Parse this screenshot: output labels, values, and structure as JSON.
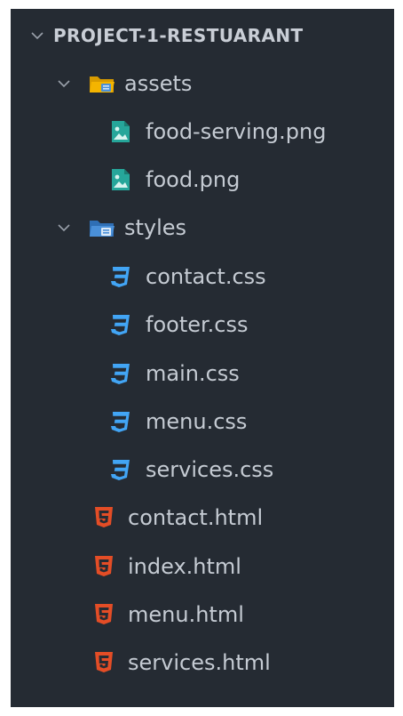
{
  "explorer": {
    "root": {
      "label": "PROJECT-1-RESTUARANT",
      "expanded": true,
      "icon": "chevron-down-icon"
    },
    "folders": [
      {
        "label": "assets",
        "expanded": true,
        "icon": "folder-open-images-icon",
        "files": [
          {
            "label": "food-serving.png",
            "icon": "image-file-icon"
          },
          {
            "label": "food.png",
            "icon": "image-file-icon"
          }
        ]
      },
      {
        "label": "styles",
        "expanded": true,
        "icon": "folder-open-styles-icon",
        "files": [
          {
            "label": "contact.css",
            "icon": "css3-icon"
          },
          {
            "label": "footer.css",
            "icon": "css3-icon"
          },
          {
            "label": "main.css",
            "icon": "css3-icon"
          },
          {
            "label": "menu.css",
            "icon": "css3-icon"
          },
          {
            "label": "services.css",
            "icon": "css3-icon"
          }
        ]
      }
    ],
    "files": [
      {
        "label": "contact.html",
        "icon": "html5-icon"
      },
      {
        "label": "index.html",
        "icon": "html5-icon"
      },
      {
        "label": "menu.html",
        "icon": "html5-icon"
      },
      {
        "label": "services.html",
        "icon": "html5-icon"
      }
    ]
  },
  "colors": {
    "background": "#252b33",
    "text": "#c5cbd3",
    "css_blue": "#42a5f5",
    "html_orange": "#e44d26",
    "image_green": "#26a69a",
    "folder_yellow": "#f4b400",
    "folder_blue": "#4a90d9"
  }
}
